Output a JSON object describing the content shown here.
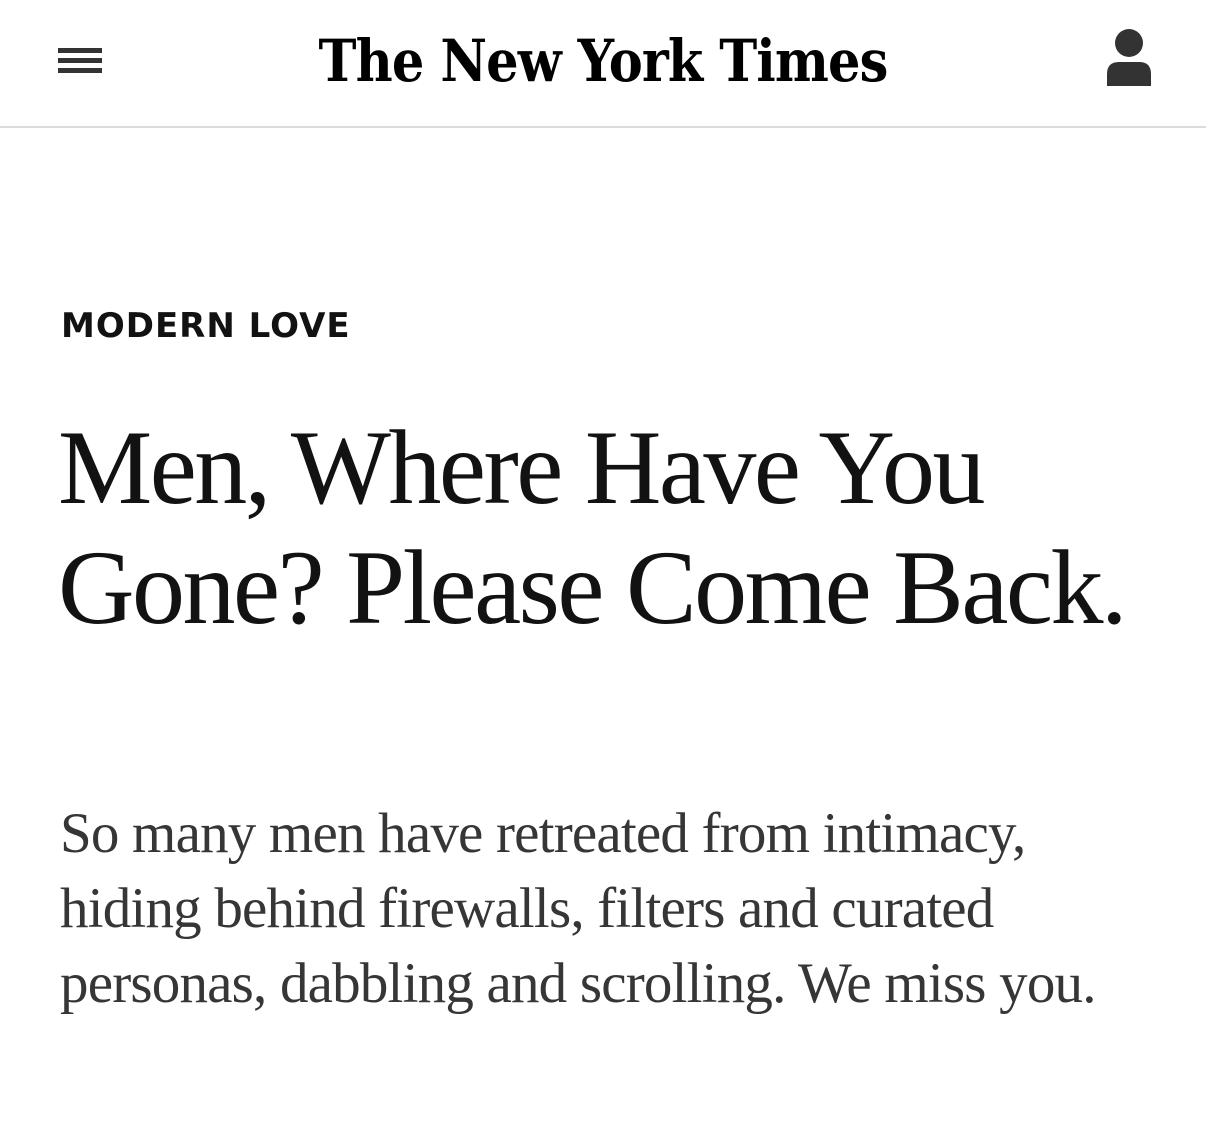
{
  "header": {
    "menu_icon": "hamburger-menu-icon",
    "logo_text": "The New York Times",
    "account_icon": "user-account-icon"
  },
  "article": {
    "kicker": "MODERN LOVE",
    "headline": "Men, Where Have You Gone? Please Come Back.",
    "summary": "So many men have retreated from intimacy, hiding behind firewalls, filters and curated personas, dabbling and scrolling. We miss you."
  },
  "colors": {
    "text": "#121212",
    "summary_text": "#363636",
    "icon": "#333333",
    "divider": "#dcdcdc",
    "background": "#ffffff"
  }
}
